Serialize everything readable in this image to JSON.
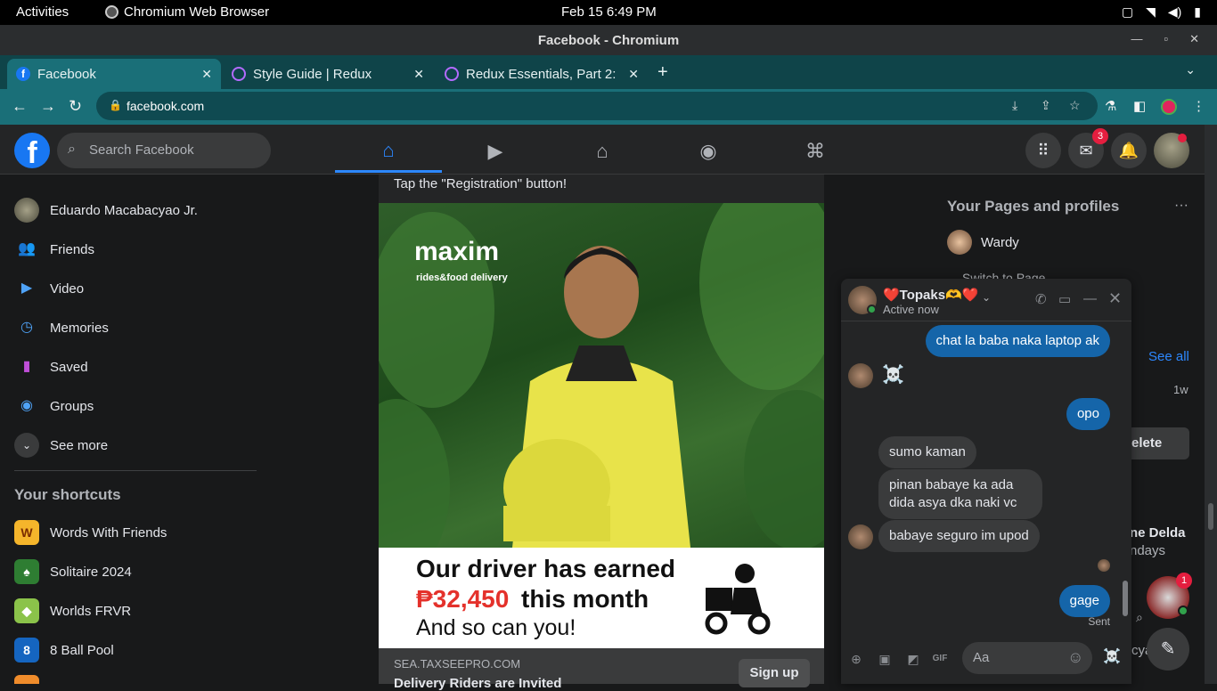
{
  "gnome": {
    "activities": "Activities",
    "app": "Chromium Web Browser",
    "clock": "Feb 15  6:49 PM"
  },
  "window": {
    "title": "Facebook - Chromium"
  },
  "tabs": [
    {
      "label": "Facebook"
    },
    {
      "label": "Style Guide | Redux"
    },
    {
      "label": "Redux Essentials, Part 2:"
    }
  ],
  "omnibox": {
    "url": "facebook.com"
  },
  "header": {
    "search_placeholder": "Search Facebook",
    "messenger_badge": "3"
  },
  "sidebar": {
    "items": [
      {
        "label": "Eduardo Macabacyao Jr."
      },
      {
        "label": "Friends"
      },
      {
        "label": "Video"
      },
      {
        "label": "Memories"
      },
      {
        "label": "Saved"
      },
      {
        "label": "Groups"
      },
      {
        "label": "See more"
      }
    ],
    "shortcuts_title": "Your shortcuts",
    "shortcuts": [
      {
        "label": "Words With Friends"
      },
      {
        "label": "Solitaire 2024"
      },
      {
        "label": "Worlds FRVR"
      },
      {
        "label": "8 Ball Pool"
      }
    ]
  },
  "post": {
    "text": "Tap the \"Registration\" button!",
    "ad_brand": "maxim",
    "ad_tagline": "rides&food delivery",
    "banner_line1": "Our driver has earned",
    "banner_amount": "₱32,450",
    "banner_line2": "this month",
    "banner_line3": "And so can you!",
    "domain": "SEA.TAXSEEPRO.COM",
    "headline": "Delivery Riders are Invited",
    "cta": "Sign up"
  },
  "right": {
    "pages_title": "Your Pages and profiles",
    "page_name": "Wardy",
    "switch_label": "Switch to Page",
    "see_all": "See all",
    "time": "1w",
    "delete_btn": "elete",
    "contact_name": "ne Delda",
    "contact_sub": "ndays",
    "cut_text": "cya",
    "chathead_badge": "1"
  },
  "chat": {
    "name": "❤️Topaks🫶❤️",
    "status": "Active now",
    "messages": [
      {
        "text": "chat la baba naka laptop ak"
      },
      {
        "text": "☠️"
      },
      {
        "text": "opo"
      },
      {
        "text": "sumo kaman"
      },
      {
        "text": "pinan babaye ka ada dida asya dka naki vc"
      },
      {
        "text": "babaye seguro im upod"
      },
      {
        "text": "gage"
      }
    ],
    "sent_label": "Sent",
    "input_placeholder": "Aa"
  }
}
